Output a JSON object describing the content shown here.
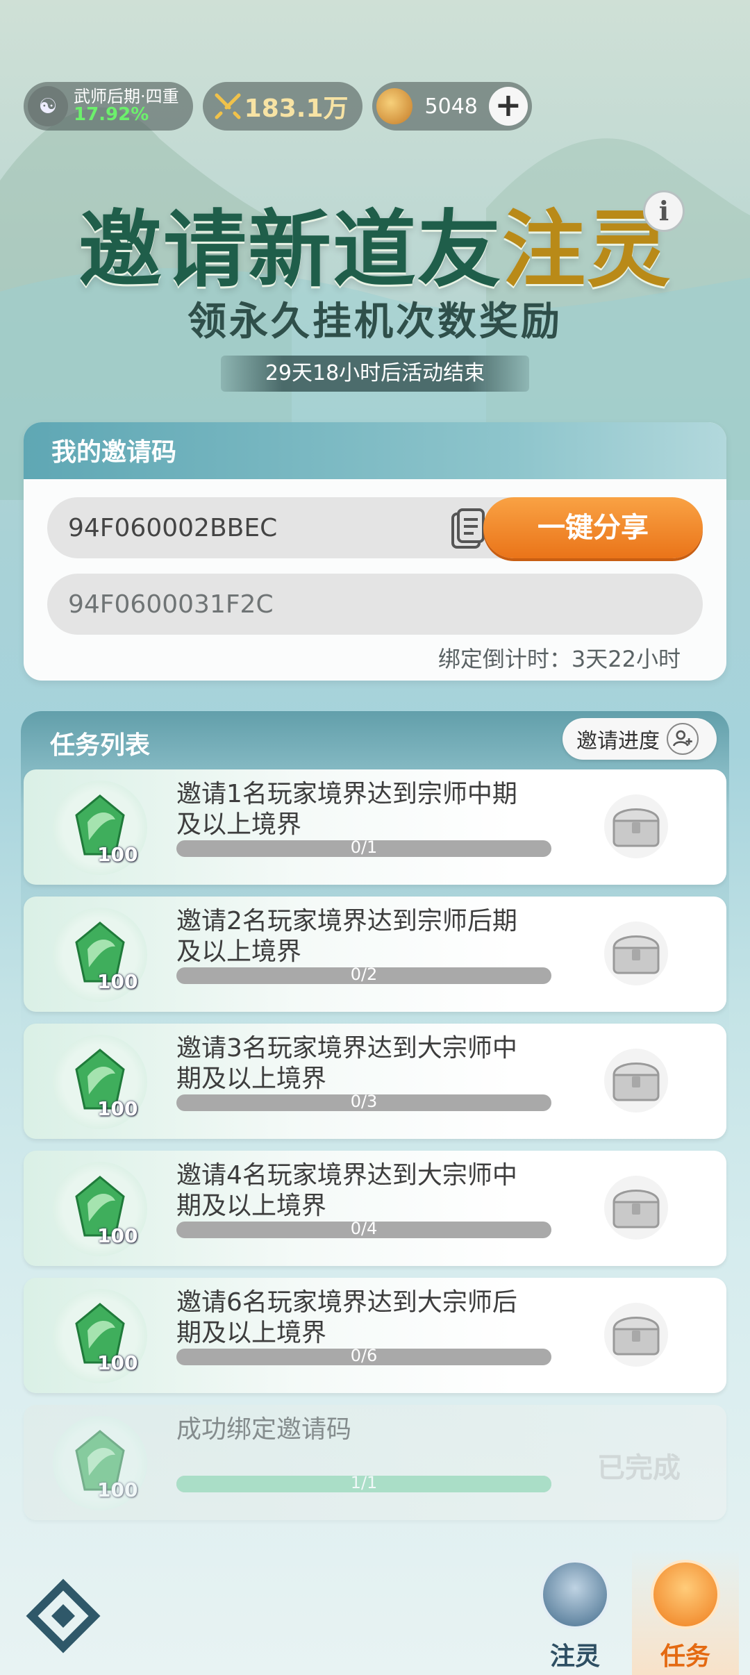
{
  "header": {
    "realm_name": "武师后期·四重",
    "realm_progress": "17.92%",
    "power": "183.1万",
    "currency": "5048",
    "add_label": "+"
  },
  "hero": {
    "title_part1": "邀请新道友",
    "title_part2": "注灵",
    "subtitle": "领永久挂机次数奖励",
    "event_countdown": "29天18小时后活动结束",
    "info_label": "i"
  },
  "invite_card": {
    "heading": "我的邀请码",
    "my_code": "94F060002BBEC",
    "share_label": "一键分享",
    "bound_code": "94F0600031F2C",
    "bind_countdown": "绑定倒计时：3天22小时"
  },
  "tasks_panel": {
    "heading": "任务列表",
    "progress_button": "邀请进度",
    "tasks": [
      {
        "line1": "邀请1名玩家境界达到宗师中期",
        "line2": "及以上境界",
        "qty": "100",
        "progress": "0/1",
        "fraction": 0
      },
      {
        "line1": "邀请2名玩家境界达到宗师后期",
        "line2": "及以上境界",
        "qty": "100",
        "progress": "0/2",
        "fraction": 0
      },
      {
        "line1": "邀请3名玩家境界达到大宗师中",
        "line2": "期及以上境界",
        "qty": "100",
        "progress": "0/3",
        "fraction": 0
      },
      {
        "line1": "邀请4名玩家境界达到大宗师中",
        "line2": "期及以上境界",
        "qty": "100",
        "progress": "0/4",
        "fraction": 0
      },
      {
        "line1": "邀请6名玩家境界达到大宗师后",
        "line2": "期及以上境界",
        "qty": "100",
        "progress": "0/6",
        "fraction": 0
      },
      {
        "line1": "成功绑定邀请码",
        "line2": "",
        "qty": "100",
        "progress": "1/1",
        "fraction": 1,
        "status": "已完成"
      }
    ]
  },
  "bottom_nav": {
    "tab_zhuling": "注灵",
    "tab_renwu": "任务",
    "active": "任务"
  },
  "colors": {
    "accent_orange": "#ea7419",
    "title_green": "#1f5e4a",
    "progress_fill": "#7fd0a6"
  }
}
